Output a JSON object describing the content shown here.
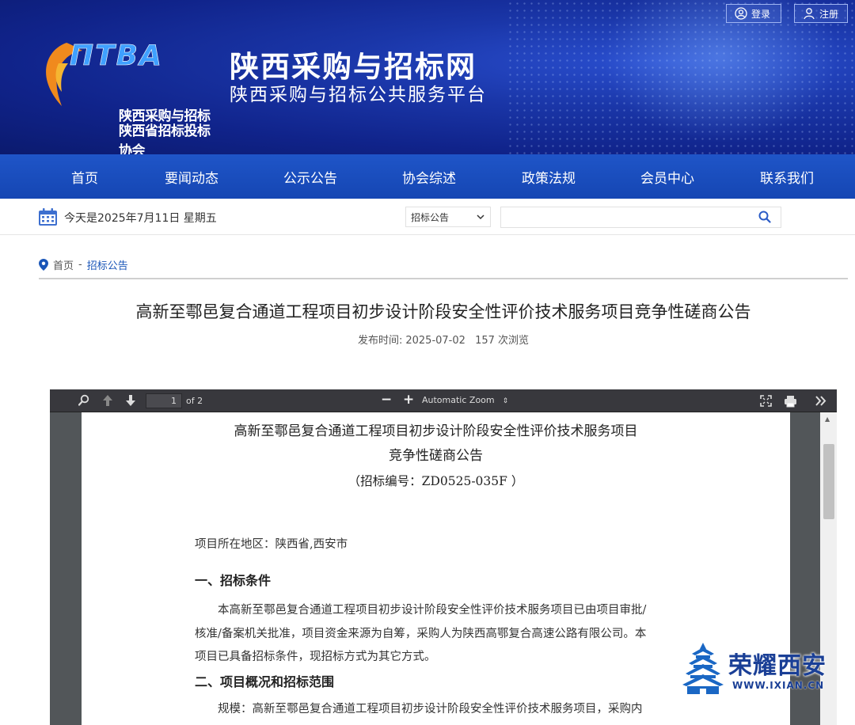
{
  "header": {
    "logo_lettering": "ΠTBA",
    "logo_cn_line1": "陕西采购与招标",
    "logo_cn_line2": "陕西省招标投标协会",
    "site_title": "陕西采购与招标网",
    "site_subtitle": "陕西采购与招标公共服务平台",
    "login_label": "登录",
    "register_label": "注册"
  },
  "nav": {
    "items": [
      "首页",
      "要闻动态",
      "公示公告",
      "协会综述",
      "政策法规",
      "会员中心",
      "联系我们"
    ]
  },
  "toolbar": {
    "date_text": "今天是2025年7月11日 星期五",
    "search_category": "招标公告",
    "search_placeholder": ""
  },
  "breadcrumb": {
    "home": "首页",
    "separator": "-",
    "current": "招标公告"
  },
  "article": {
    "title": "高新至鄠邑复合通道工程项目初步设计阶段安全性评价技术服务项目竞争性磋商公告",
    "publish_label": "发布时间:",
    "publish_date": "2025-07-02",
    "views": "157 次浏览"
  },
  "pdf_viewer": {
    "page_current": "1",
    "page_total_text": "of 2",
    "zoom_label": "Automatic Zoom",
    "document": {
      "title_line1": "高新至鄠邑复合通道工程项目初步设计阶段安全性评价技术服务项目",
      "title_line2": "竞争性磋商公告",
      "bid_number": "（招标编号：ZD0525-035F ）",
      "region": "项目所在地区：陕西省,西安市",
      "section1_heading": "一、招标条件",
      "section1_p1": "本高新至鄠邑复合通道工程项目初步设计阶段安全性评价技术服务项目已由项目审批/",
      "section1_p2": "核准/备案机关批准，项目资金来源为自筹，采购人为陕西高鄂复合高速公路有限公司。本",
      "section1_p3": "项目已具备招标条件，现招标方式为其它方式。",
      "section2_heading": "二、项目概况和招标范围",
      "section2_p1": "规模：高新至鄠邑复合通道工程项目初步设计阶段安全性评价技术服务项目，采购内"
    }
  },
  "watermark": {
    "text": "荣耀西安",
    "url": "WWW.IXIAN.CN"
  },
  "colors": {
    "nav_blue": "#1a4fbf",
    "banner_blue": "#13288f",
    "breadcrumb_active": "#1a56b8",
    "pdf_toolbar": "#38383d"
  }
}
